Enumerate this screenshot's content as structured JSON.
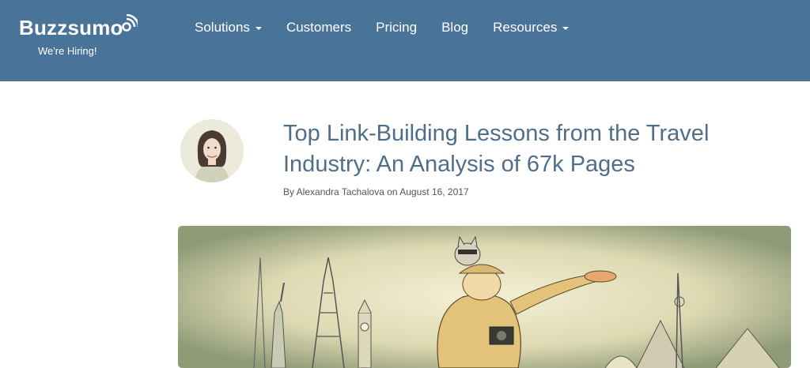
{
  "header": {
    "logo_text": "Buzzsumo",
    "hiring_text": "We're Hiring!",
    "nav": [
      {
        "label": "Solutions",
        "has_dropdown": true
      },
      {
        "label": "Customers",
        "has_dropdown": false
      },
      {
        "label": "Pricing",
        "has_dropdown": false
      },
      {
        "label": "Blog",
        "has_dropdown": false
      },
      {
        "label": "Resources",
        "has_dropdown": true
      }
    ]
  },
  "article": {
    "title": "Top Link-Building Lessons from the Travel Industry: An Analysis of 67k Pages",
    "byline": "By Alexandra Tachalova on August 16, 2017"
  },
  "colors": {
    "header_bg": "#4a7399",
    "title": "#4e6e8c",
    "text": "#555555"
  },
  "icons": [
    "wifi-signal-icon",
    "caret-down-icon"
  ]
}
